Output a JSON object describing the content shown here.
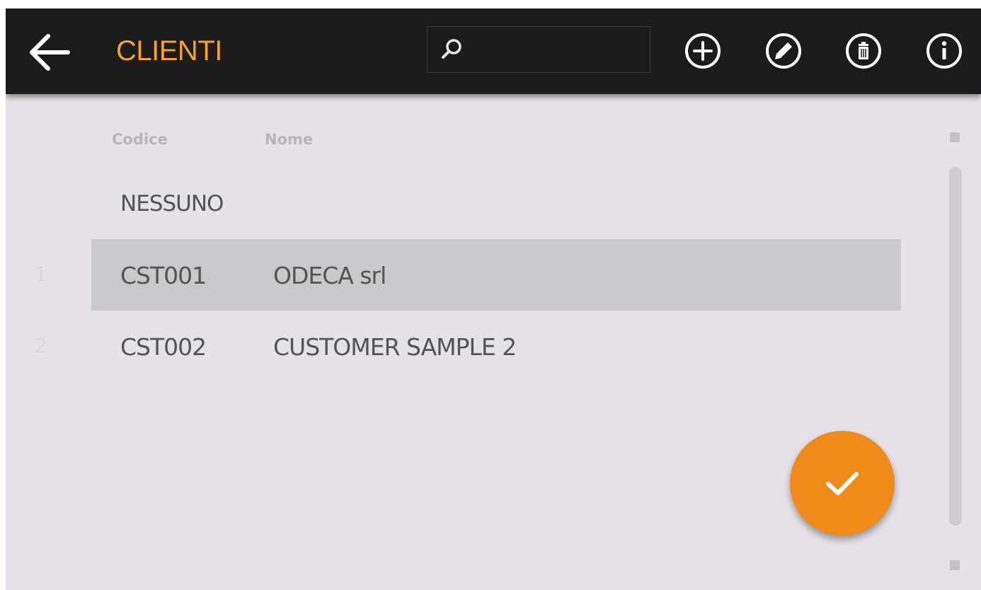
{
  "toolbar": {
    "title": "CLIENTI",
    "search_value": "",
    "search_placeholder": "",
    "buttons": [
      "add-icon",
      "edit-icon",
      "delete-icon",
      "info-icon"
    ]
  },
  "table": {
    "columns": [
      "Codice",
      "Nome"
    ],
    "rows": [
      {
        "num": "",
        "code": "NESSUNO",
        "name": ""
      },
      {
        "num": "1",
        "code": "CST001",
        "name": "ODECA srl",
        "selected": true
      },
      {
        "num": "2",
        "code": "CST002",
        "name": "CUSTOMER SAMPLE 2"
      }
    ]
  },
  "colors": {
    "accent": "#f08a1a",
    "title": "#f5a030",
    "toolbar_bg": "#1b1b1b",
    "content_bg": "#e6e3e8",
    "selected_row": "#c9c8ca"
  }
}
